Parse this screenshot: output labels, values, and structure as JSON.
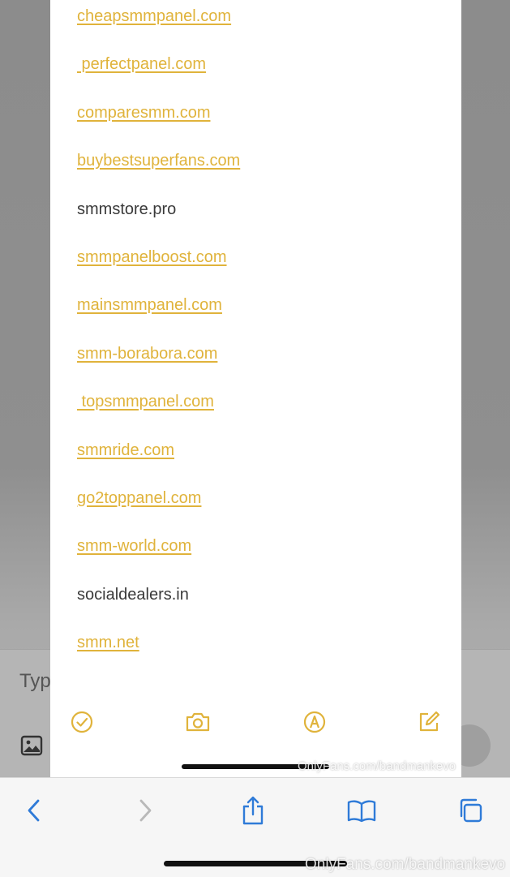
{
  "background": {
    "compose_placeholder": "Typ"
  },
  "note": {
    "items": [
      {
        "text": "cheapsmmpanel.com",
        "is_link": true
      },
      {
        "text": " perfectpanel.com",
        "is_link": true
      },
      {
        "text": "comparesmm.com",
        "is_link": true
      },
      {
        "text": "buybestsuperfans.com",
        "is_link": true
      },
      {
        "text": "smmstore.pro",
        "is_link": false
      },
      {
        "text": "smmpanelboost.com",
        "is_link": true
      },
      {
        "text": "mainsmmpanel.com",
        "is_link": true
      },
      {
        "text": "smm-borabora.com",
        "is_link": true
      },
      {
        "text": " topsmmpanel.com",
        "is_link": true
      },
      {
        "text": "smmride.com",
        "is_link": true
      },
      {
        "text": "go2toppanel.com",
        "is_link": true
      },
      {
        "text": "smm-world.com",
        "is_link": true
      },
      {
        "text": "socialdealers.in",
        "is_link": false
      },
      {
        "text": "smm.net",
        "is_link": true
      }
    ],
    "toolbar": [
      "checklist-icon",
      "camera-icon",
      "markup-icon",
      "compose-icon"
    ]
  },
  "watermark": {
    "small": "OnlyFans.com/bandmankevo",
    "large": "OnlyFans.com/bandmankevo"
  },
  "safari_toolbar": [
    "back-icon",
    "forward-icon",
    "share-icon",
    "bookmarks-icon",
    "tabs-icon"
  ],
  "colors": {
    "link": "#e0b33b",
    "accent": "#2f7bd8"
  }
}
